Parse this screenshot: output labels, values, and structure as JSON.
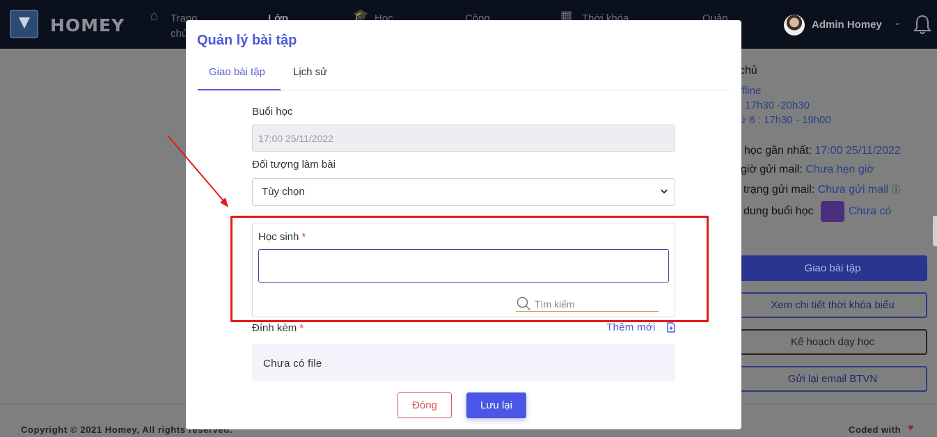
{
  "nav": {
    "brand": "HOMEY",
    "items": [
      "Trang chủ",
      "Lớp",
      "Học",
      "Công",
      "Thời khóa",
      "Quản"
    ],
    "user": "Admin Homey"
  },
  "background": {
    "heading_partial": "chủ",
    "mode": "ffline",
    "schedule_1": ": 17h30 -20h30",
    "schedule_2": "ứ 6 : 17h30 - 19h00",
    "latest_label": "học gần nhất: ",
    "latest_value": "17:00 25/11/2022",
    "mail_time_label": "giờ gửi mail: ",
    "mail_time_value": "Chưa hẹn giờ",
    "mail_status_label": "trạng gửi mail: ",
    "mail_status_value": "Chưa gửi mail",
    "content_label": "dung buổi học",
    "content_value": "Chưa có",
    "btn_assign": "Giao bài tập",
    "btn_schedule": "Xem chi tiết thời khóa biểu",
    "btn_plan": "Kế hoạch dạy học",
    "btn_resend": "Gửi lại email BTVN"
  },
  "footer": {
    "copyright": "Copyright © 2021 Homey, All rights reserved.",
    "coded": "Coded with"
  },
  "modal": {
    "title": "Quản lý bài tập",
    "tabs": [
      "Giao bài tập",
      "Lịch sử"
    ],
    "session_label": "Buổi học",
    "session_value": "17:00 25/11/2022",
    "target_label": "Đối tượng làm bài",
    "target_value": "Tùy chọn",
    "student_label": "Học sinh",
    "required_mark": "*",
    "search_placeholder": "Tìm kiếm",
    "attach_label": "Đính kèm",
    "attach_add": "Thêm mới",
    "no_file": "Chưa có file",
    "btn_close": "Đóng",
    "btn_save": "Lưu lại"
  },
  "colors": {
    "accent": "#4b56e6",
    "annotation": "#e21a1a",
    "navbar": "#0b101d"
  }
}
